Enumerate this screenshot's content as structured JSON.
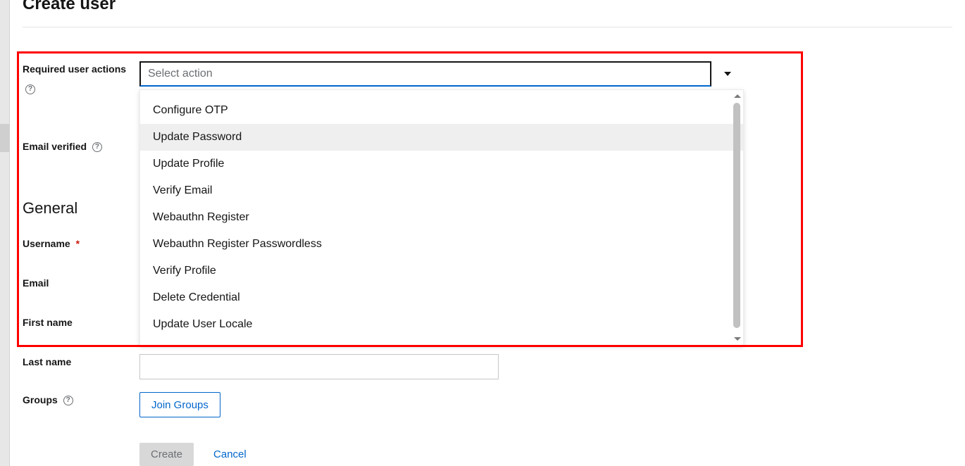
{
  "page": {
    "title": "Create user"
  },
  "form": {
    "required_actions": {
      "label": "Required user actions",
      "placeholder": "Select action",
      "options": [
        "Configure OTP",
        "Update Password",
        "Update Profile",
        "Verify Email",
        "Webauthn Register",
        "Webauthn Register Passwordless",
        "Verify Profile",
        "Delete Credential",
        "Update User Locale"
      ],
      "hovered_index": 1
    },
    "email_verified": {
      "label": "Email verified"
    },
    "section_general": "General",
    "username": {
      "label": "Username",
      "required": true,
      "value": ""
    },
    "email": {
      "label": "Email",
      "value": ""
    },
    "first_name": {
      "label": "First name",
      "value": ""
    },
    "last_name": {
      "label": "Last name",
      "value": ""
    },
    "groups": {
      "label": "Groups",
      "button": "Join Groups"
    }
  },
  "actions": {
    "create": "Create",
    "cancel": "Cancel"
  },
  "colors": {
    "accent": "#06c",
    "danger": "#c9190b",
    "highlight": "#ff0000"
  }
}
